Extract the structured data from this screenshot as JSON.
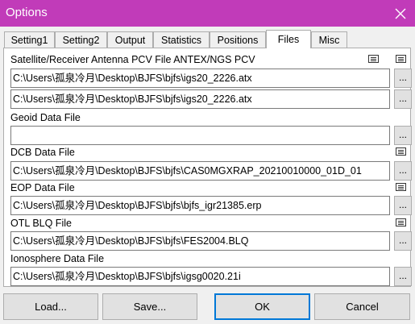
{
  "window": {
    "title": "Options",
    "close_icon": "close-icon"
  },
  "tabs": [
    {
      "label": "Setting1"
    },
    {
      "label": "Setting2"
    },
    {
      "label": "Output"
    },
    {
      "label": "Statistics"
    },
    {
      "label": "Positions"
    },
    {
      "label": "Files",
      "selected": true
    },
    {
      "label": "Misc"
    }
  ],
  "files": {
    "antenna_label": "Satellite/Receiver Antenna PCV File ANTEX/NGS PCV",
    "antenna_sat_path": "C:\\Users\\孤泉冷月\\Desktop\\BJFS\\bjfs\\igs20_2226.atx",
    "antenna_rcv_path": "C:\\Users\\孤泉冷月\\Desktop\\BJFS\\bjfs\\igs20_2226.atx",
    "geoid_label": "Geoid Data File",
    "geoid_path": "",
    "dcb_label": "DCB Data File",
    "dcb_path": "C:\\Users\\孤泉冷月\\Desktop\\BJFS\\bjfs\\CAS0MGXRAP_20210010000_01D_01",
    "eop_label": "EOP Data File",
    "eop_path": "C:\\Users\\孤泉冷月\\Desktop\\BJFS\\bjfs\\bjfs_igr21385.erp",
    "otl_label": "OTL BLQ File",
    "otl_path": "C:\\Users\\孤泉冷月\\Desktop\\BJFS\\bjfs\\FES2004.BLQ",
    "iono_label": "Ionosphere Data File",
    "iono_path": "C:\\Users\\孤泉冷月\\Desktop\\BJFS\\bjfs\\igsg0020.21i",
    "browse_label": "..."
  },
  "buttons": {
    "load": "Load...",
    "save": "Save...",
    "ok": "OK",
    "cancel": "Cancel"
  },
  "colors": {
    "titlebar": "#c13bb9",
    "default_button_border": "#0078d7"
  }
}
